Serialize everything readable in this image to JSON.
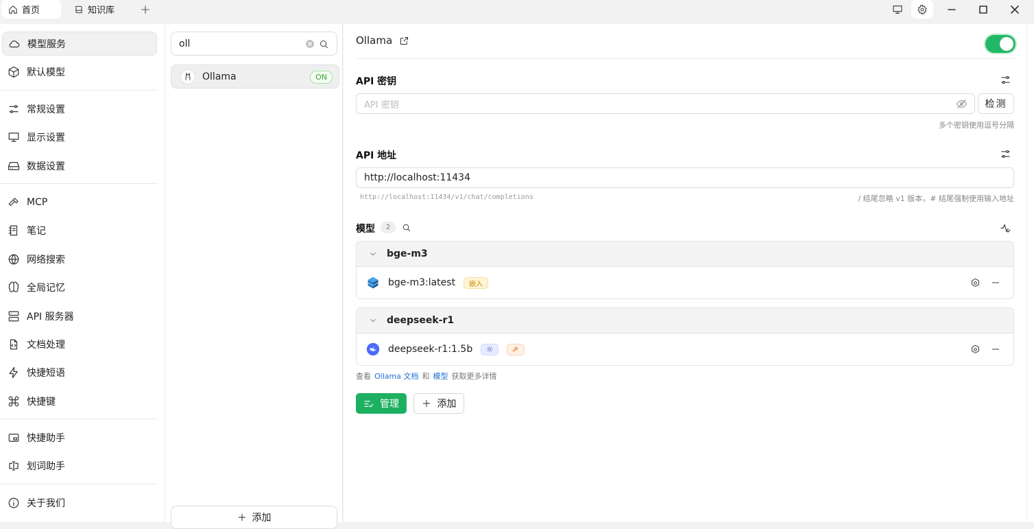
{
  "tabs": [
    {
      "label": "首页",
      "icon": "home-icon"
    },
    {
      "label": "知识库",
      "icon": "book-icon"
    }
  ],
  "nav": {
    "items": [
      {
        "label": "模型服务",
        "icon": "cloud-icon"
      },
      {
        "label": "默认模型",
        "icon": "cube-icon"
      },
      {
        "label": "常规设置",
        "icon": "sliders-icon"
      },
      {
        "label": "显示设置",
        "icon": "monitor-icon"
      },
      {
        "label": "数据设置",
        "icon": "storage-icon"
      },
      {
        "label": "MCP",
        "icon": "hammer-icon"
      },
      {
        "label": "笔记",
        "icon": "notebook-icon"
      },
      {
        "label": "网络搜索",
        "icon": "globe-icon"
      },
      {
        "label": "全局记忆",
        "icon": "brain-icon"
      },
      {
        "label": "API 服务器",
        "icon": "server-icon"
      },
      {
        "label": "文档处理",
        "icon": "file-code-icon"
      },
      {
        "label": "快捷短语",
        "icon": "zap-icon"
      },
      {
        "label": "快捷键",
        "icon": "command-icon"
      },
      {
        "label": "快捷助手",
        "icon": "window-icon"
      },
      {
        "label": "划词助手",
        "icon": "text-cursor-icon"
      },
      {
        "label": "关于我们",
        "icon": "info-icon"
      }
    ]
  },
  "provider_list": {
    "search_value": "oll",
    "providers": [
      {
        "name": "Ollama",
        "status": "ON"
      }
    ],
    "add_label": "添加"
  },
  "main": {
    "provider_name": "Ollama",
    "enabled": true,
    "api_key": {
      "title": "API 密钥",
      "placeholder": "API 密钥",
      "check_label": "检测",
      "hint": "多个密钥使用逗号分隔"
    },
    "api_url": {
      "title": "API 地址",
      "value": "http://localhost:11434",
      "preview": "http://localhost:11434/v1/chat/completions",
      "hint": "/ 结尾忽略 v1 版本，# 结尾强制使用输入地址"
    },
    "models": {
      "title": "模型",
      "count": "2",
      "groups": [
        {
          "name": "bge-m3",
          "models": [
            {
              "name": "bge-m3:latest",
              "tags": [
                "嵌入"
              ]
            }
          ]
        },
        {
          "name": "deepseek-r1",
          "models": [
            {
              "name": "deepseek-r1:1.5b",
              "tags": [
                "vision",
                "tool"
              ]
            }
          ]
        }
      ]
    },
    "footer": {
      "prefix": "查看",
      "docs_link": "Ollama 文档",
      "and": "和",
      "models_link": "模型",
      "suffix": "获取更多详情"
    },
    "manage_label": "管理",
    "add_label": "添加"
  },
  "colors": {
    "accent": "#1eb061",
    "toggle_on": "#22b868",
    "link": "#1f6fd0"
  }
}
